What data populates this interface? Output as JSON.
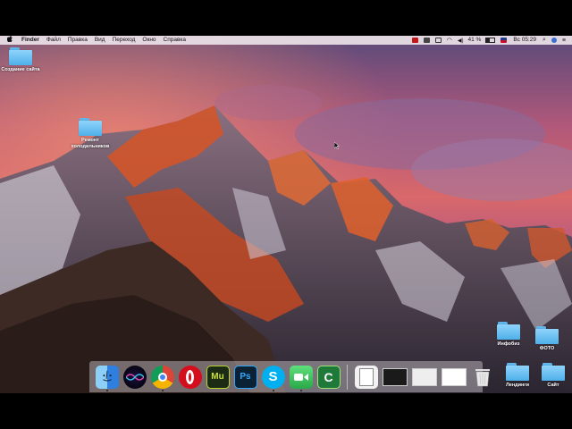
{
  "menubar": {
    "apple": "",
    "app_name": "Finder",
    "menus": [
      "Файл",
      "Правка",
      "Вид",
      "Переход",
      "Окно",
      "Справка"
    ],
    "battery": "41 %",
    "clock": "Вс 05:29"
  },
  "desktop": {
    "icons": [
      {
        "label": "Создание сайта"
      },
      {
        "label": "Ремонт холодильников"
      },
      {
        "label": "Инфобиз"
      },
      {
        "label": "ФОТО"
      },
      {
        "label": "Лендинги"
      },
      {
        "label": "Сайт"
      }
    ]
  },
  "dock": {
    "apps": [
      {
        "name": "Finder",
        "icon": "finder-icon",
        "color": "#2f8ff0"
      },
      {
        "name": "Siri",
        "icon": "siri-icon",
        "color": "#3a2a6a"
      },
      {
        "name": "Chrome",
        "icon": "chrome-icon",
        "color": "#dd4b39"
      },
      {
        "name": "Opera",
        "icon": "opera-icon",
        "color": "#d40e1c"
      },
      {
        "name": "Muse",
        "icon": "muse-icon",
        "text": "Mu",
        "color": "#1b2b14"
      },
      {
        "name": "Photoshop",
        "icon": "photoshop-icon",
        "text": "Ps",
        "color": "#0b2234"
      },
      {
        "name": "Skype",
        "icon": "skype-icon",
        "color": "#00aff0"
      },
      {
        "name": "FaceTime",
        "icon": "facetime-icon",
        "color": "#35c759"
      },
      {
        "name": "Camtasia",
        "icon": "camtasia-icon",
        "text": "C",
        "color": "#1f7a3a"
      }
    ],
    "trash_icon": "trash-icon"
  }
}
